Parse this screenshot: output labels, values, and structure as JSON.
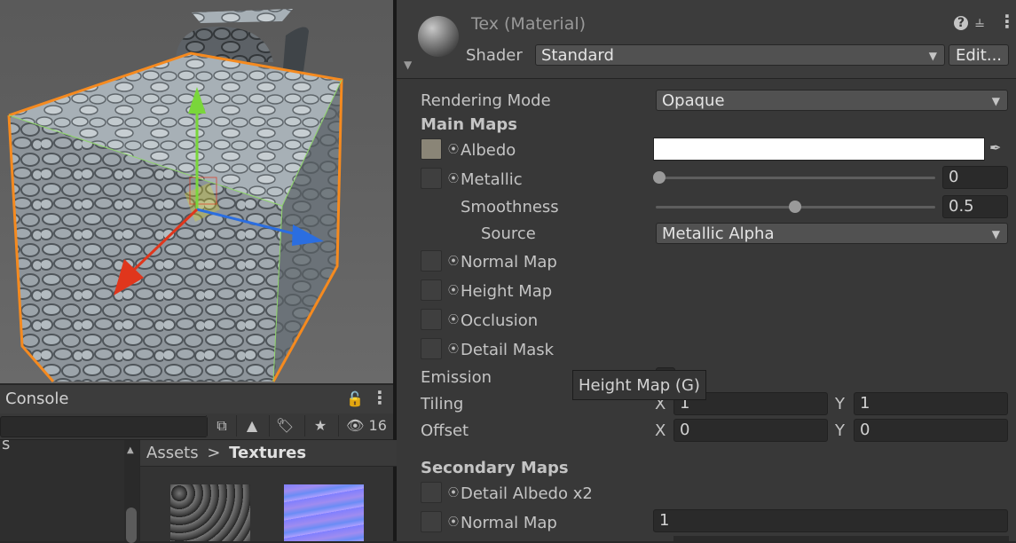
{
  "console": {
    "tab_label": "Console",
    "hidden_count": "16"
  },
  "project": {
    "left_partial_text": "s",
    "breadcrumb_root": "Assets",
    "breadcrumb_separator": ">",
    "breadcrumb_current": "Textures"
  },
  "inspector": {
    "material_name": "Tex (Material)",
    "shader_label": "Shader",
    "shader_value": "Standard",
    "edit_button": "Edit...",
    "rendering_mode_label": "Rendering Mode",
    "rendering_mode_value": "Opaque",
    "main_maps_label": "Main Maps",
    "albedo_label": "Albedo",
    "metallic_label": "Metallic",
    "metallic_value": "0",
    "smoothness_label": "Smoothness",
    "smoothness_value": "0.5",
    "source_label": "Source",
    "source_value": "Metallic Alpha",
    "normal_map_label": "Normal Map",
    "height_map_label": "Height Map",
    "occlusion_label": "Occlusion",
    "detail_mask_label": "Detail Mask",
    "emission_label": "Emission",
    "tiling_label": "Tiling",
    "tiling_x_label": "X",
    "tiling_x_value": "1",
    "tiling_y_label": "Y",
    "tiling_y_value": "1",
    "offset_label": "Offset",
    "offset_x_label": "X",
    "offset_x_value": "0",
    "offset_y_label": "Y",
    "offset_y_value": "0",
    "secondary_maps_label": "Secondary Maps",
    "detail_albedo_label": "Detail Albedo x2",
    "secondary_normal_label": "Normal Map",
    "secondary_normal_value": "1"
  },
  "tooltip": {
    "text": "Height Map (G)"
  },
  "colors": {
    "selection_outline": "#f58a1f",
    "gizmo_x": "#e0361c",
    "gizmo_y": "#7ad63a",
    "gizmo_z": "#2b6ee0",
    "normal_map": "#7f7fff"
  },
  "icons": [
    "help-icon",
    "preset-icon",
    "more-icon",
    "lock-icon",
    "eyedropper-icon",
    "search-icon",
    "filter-type-icon",
    "label-icon",
    "favorite-icon",
    "visibility-icon",
    "chevron-right-icon",
    "foldout-icon"
  ]
}
